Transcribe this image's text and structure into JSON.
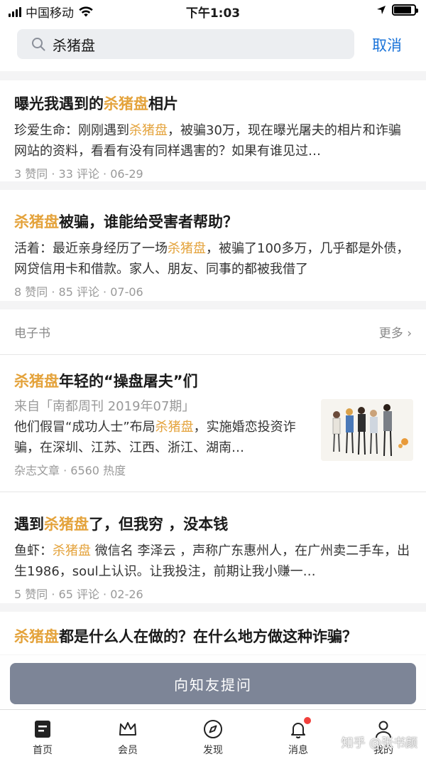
{
  "status": {
    "carrier": "中国移动",
    "time": "下午1:03"
  },
  "search": {
    "query": "杀猪盘",
    "cancel": "取消"
  },
  "highlight": "杀猪盘",
  "answers": [
    {
      "title_pre": "曝光我遇到的",
      "title_hl": "杀猪盘",
      "title_post": "相片",
      "excerpt_pre": "珍爱生命：刚刚遇到",
      "excerpt_hl": "杀猪盘",
      "excerpt_post": "，被骗30万，现在曝光屠夫的相片和诈骗网站的资料，看看有没有同样遇害的？如果有谁见过…",
      "meta": "3 赞同 · 33 评论 · 06-29"
    },
    {
      "title_pre": "",
      "title_hl": "杀猪盘",
      "title_post": "被骗，谁能给受害者帮助？",
      "excerpt_pre": "活着：最近亲身经历了一场",
      "excerpt_hl": "杀猪盘",
      "excerpt_post": "，被骗了100多万，几乎都是外债，网贷信用卡和借款。家人、朋友、同事的都被我借了",
      "meta": "8 赞同 · 85 评论 · 07-06"
    }
  ],
  "ebook_section": {
    "label": "电子书",
    "more": "更多 ›"
  },
  "ebook": {
    "title_hl": "杀猪盘",
    "title_post": "年轻的“操盘屠夫”们",
    "source": "来自「南都周刊 2019年07期」",
    "excerpt_pre": "他们假冒“成功人士”布局",
    "excerpt_hl": "杀猪盘",
    "excerpt_post": "，实施婚恋投资诈骗，在深圳、江苏、江西、浙江、湖南…",
    "meta": "杂志文章 · 6560 热度"
  },
  "answer3": {
    "title_pre": "遇到",
    "title_hl": "杀猪盘",
    "title_post": "了，但我穷 ，没本钱",
    "excerpt_pre": "鱼虾：",
    "excerpt_hl": "杀猪盘",
    "excerpt_post": " 微信名 李泽云 ，声称广东惠州人，在广州卖二手车，出生1986，soul上认识。让我投注，前期让我小赚一…",
    "meta": "5 赞同 · 65 评论 · 02-26"
  },
  "partial": {
    "title_hl": "杀猪盘",
    "title_post": "都是什么人在做的？在什么地方做这种诈骗？"
  },
  "ask_button": "向知友提问",
  "tabs": [
    {
      "label": "首页",
      "icon": "home-icon"
    },
    {
      "label": "会员",
      "icon": "crown-icon"
    },
    {
      "label": "发现",
      "icon": "compass-icon"
    },
    {
      "label": "消息",
      "icon": "bell-icon"
    },
    {
      "label": "我的",
      "icon": "person-icon"
    }
  ],
  "watermark": "知乎 @张书颜",
  "colors": {
    "highlight": "#e4a33c",
    "link": "#1a73d9",
    "ask_button": "#7d8597"
  }
}
